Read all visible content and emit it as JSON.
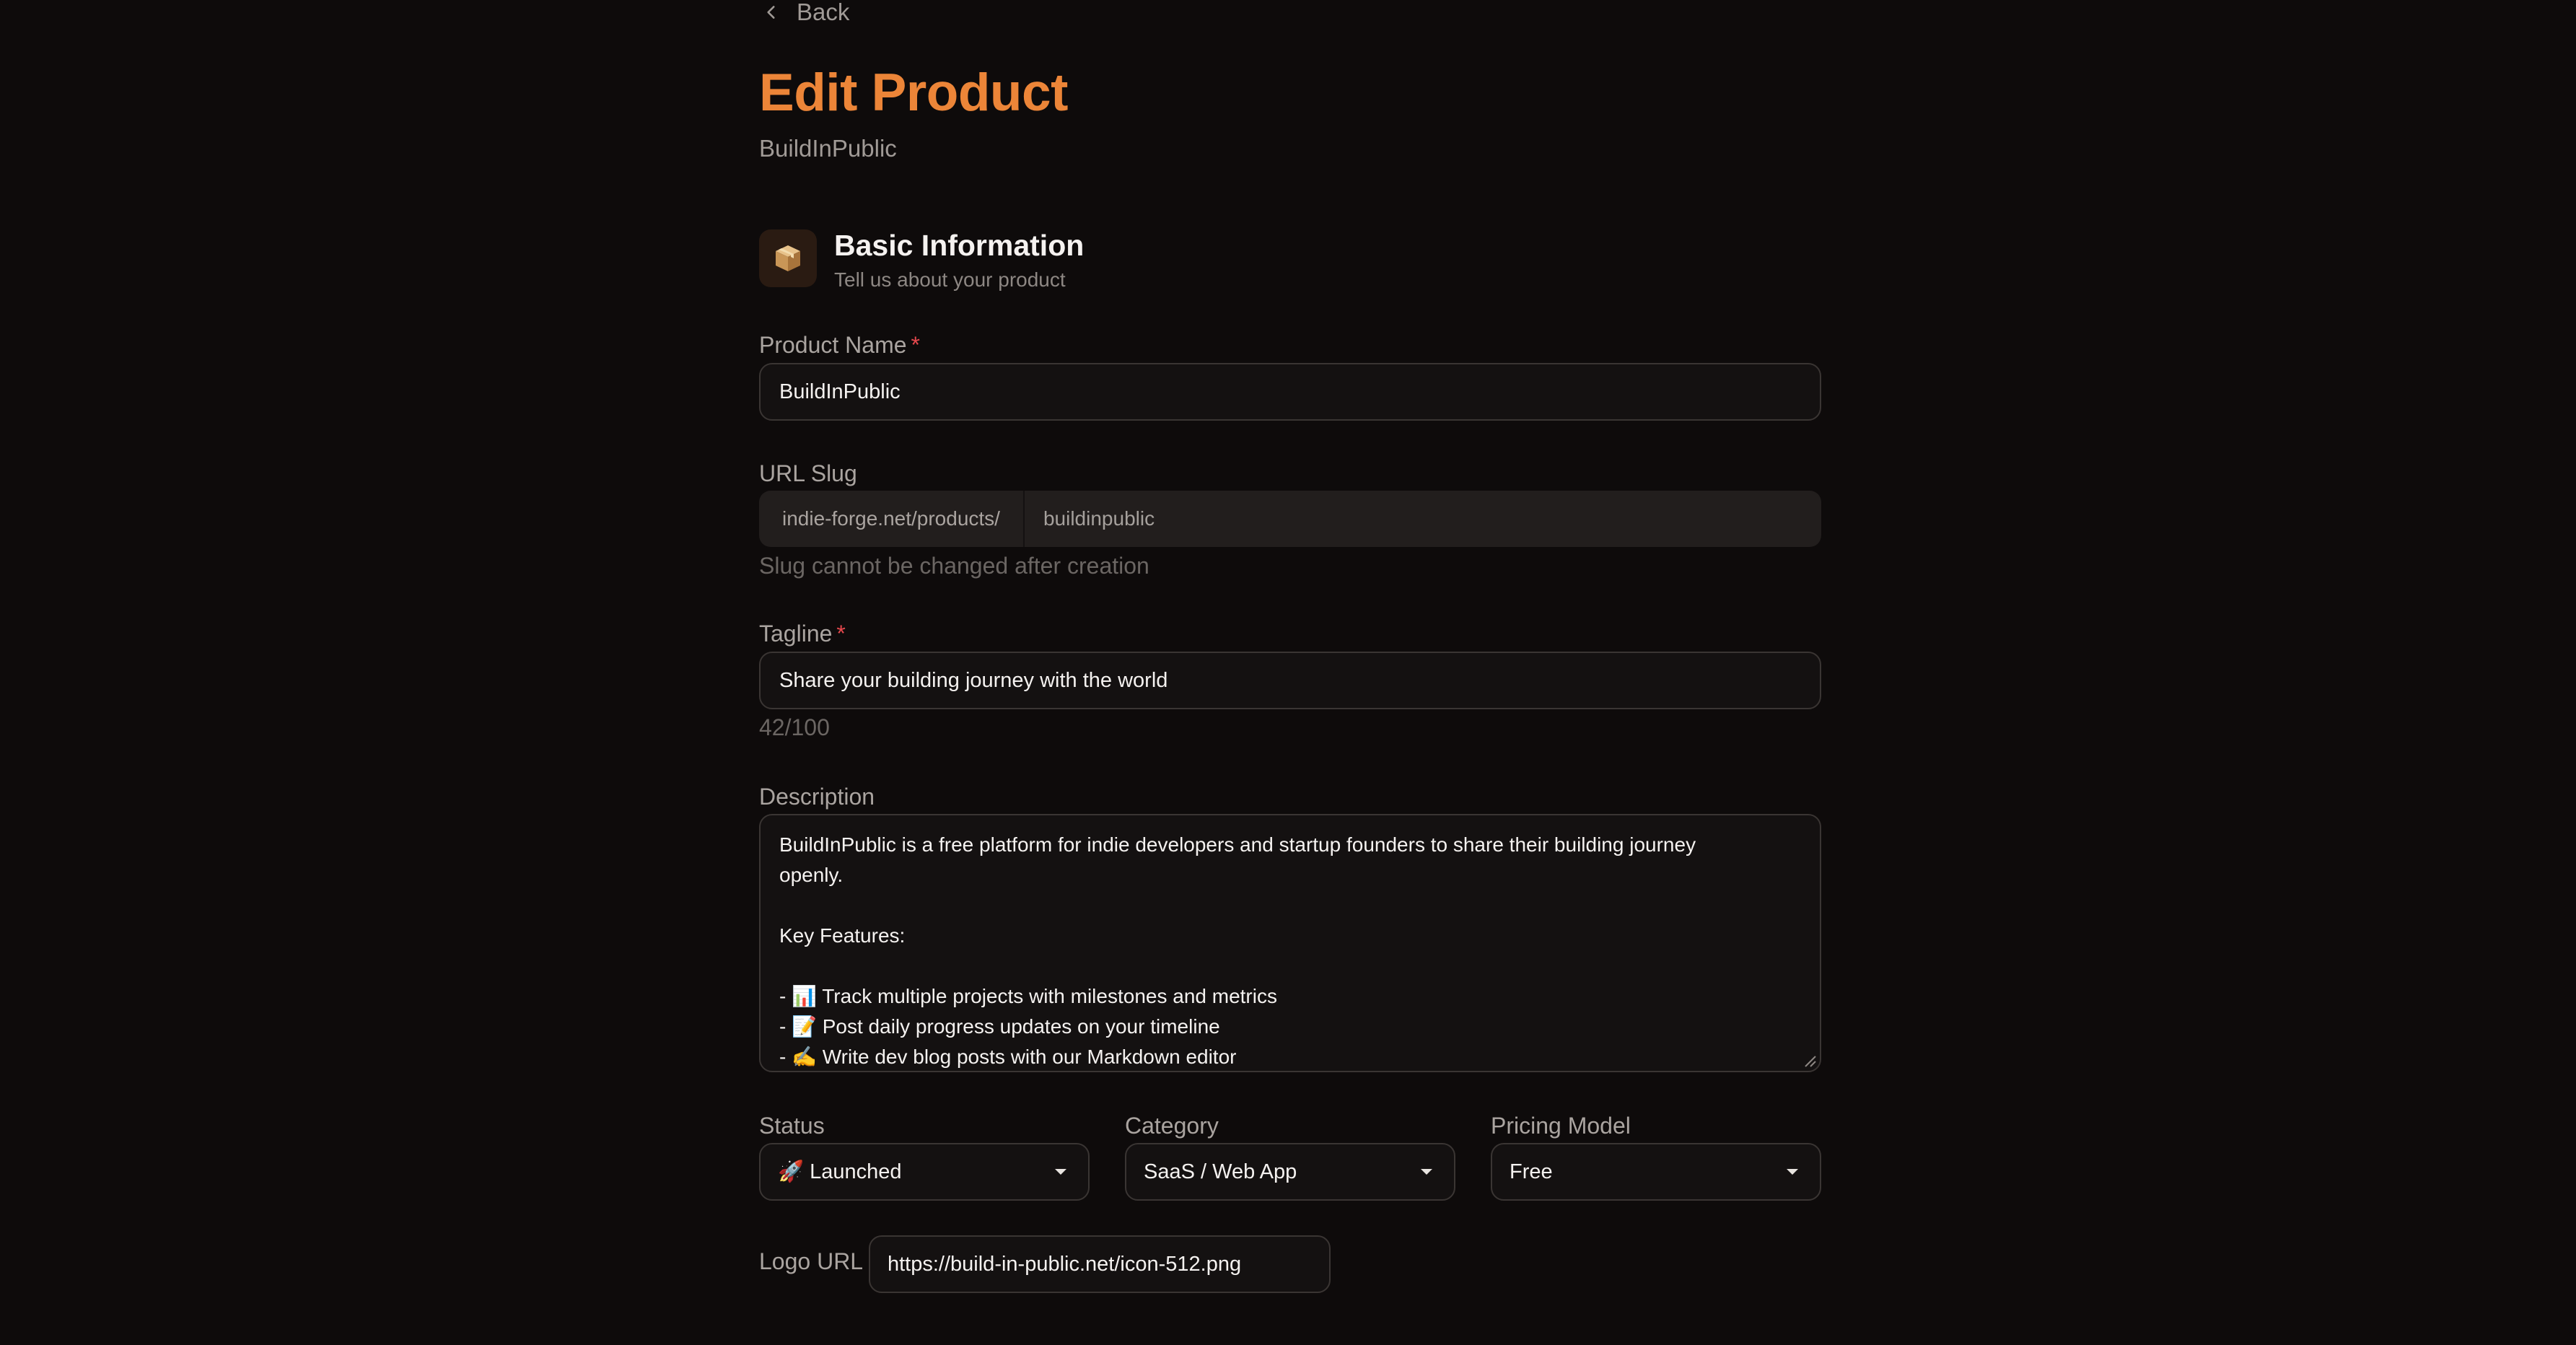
{
  "nav": {
    "back_label": "Back"
  },
  "header": {
    "title": "Edit Product",
    "subtitle": "BuildInPublic"
  },
  "section": {
    "icon": "package-icon",
    "title": "Basic Information",
    "description": "Tell us about your product"
  },
  "fields": {
    "product_name": {
      "label": "Product Name",
      "required_mark": "*",
      "value": "BuildInPublic"
    },
    "url_slug": {
      "label": "URL Slug",
      "prefix": "indie-forge.net/products/",
      "value": "buildinpublic",
      "hint": "Slug cannot be changed after creation"
    },
    "tagline": {
      "label": "Tagline",
      "required_mark": "*",
      "value": "Share your building journey with the world",
      "counter": "42/100"
    },
    "description": {
      "label": "Description",
      "lines": [
        "BuildInPublic is a free platform for indie developers and startup founders to share their building journey",
        "openly.",
        "",
        "Key Features:",
        "",
        "- 📊 Track multiple projects with milestones and metrics",
        "- 📝 Post daily progress updates on your timeline",
        "- ✍️ Write dev blog posts with our Markdown editor"
      ]
    },
    "status": {
      "label": "Status",
      "value": "🚀 Launched"
    },
    "category": {
      "label": "Category",
      "value": "SaaS / Web App"
    },
    "pricing_model": {
      "label": "Pricing Model",
      "value": "Free"
    },
    "logo_url": {
      "label": "Logo URL",
      "value": "https://build-in-public.net/icon-512.png"
    }
  },
  "colors": {
    "accent": "#ec8538",
    "background": "#0e0b0b",
    "required": "#e5484d"
  }
}
